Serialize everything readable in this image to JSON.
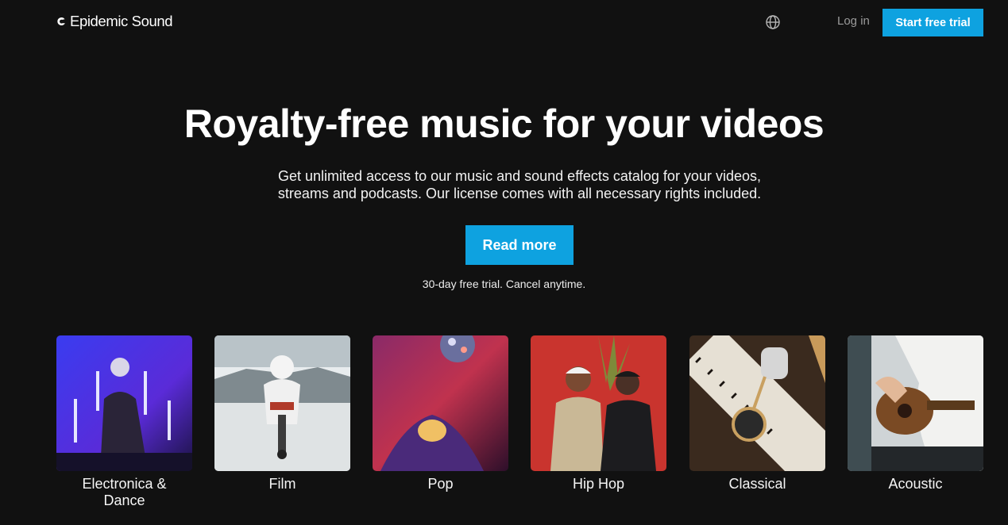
{
  "brand": {
    "name": "Epidemic Sound",
    "logo_icon": "epidemic-logo-icon"
  },
  "nav": {
    "language_icon": "globe-icon",
    "login_label": "Log in",
    "trial_label": "Start free trial"
  },
  "hero": {
    "title": "Royalty-free music for your videos",
    "subtitle_line1": "Get unlimited access to our music and sound effects catalog for your videos,",
    "subtitle_line2": "streams and podcasts. Our license comes with all necessary rights included.",
    "cta_label": "Read more",
    "note": "30-day free trial. Cancel anytime."
  },
  "genres": [
    {
      "label_line1": "Electronica &",
      "label_line2": "Dance"
    },
    {
      "label_line1": "Film",
      "label_line2": ""
    },
    {
      "label_line1": "Pop",
      "label_line2": ""
    },
    {
      "label_line1": "Hip Hop",
      "label_line2": ""
    },
    {
      "label_line1": "Classical",
      "label_line2": ""
    },
    {
      "label_line1": "Acoustic",
      "label_line2": ""
    }
  ],
  "colors": {
    "background": "#111111",
    "accent": "#0ea2e0",
    "muted_text": "#9a9a9a"
  }
}
